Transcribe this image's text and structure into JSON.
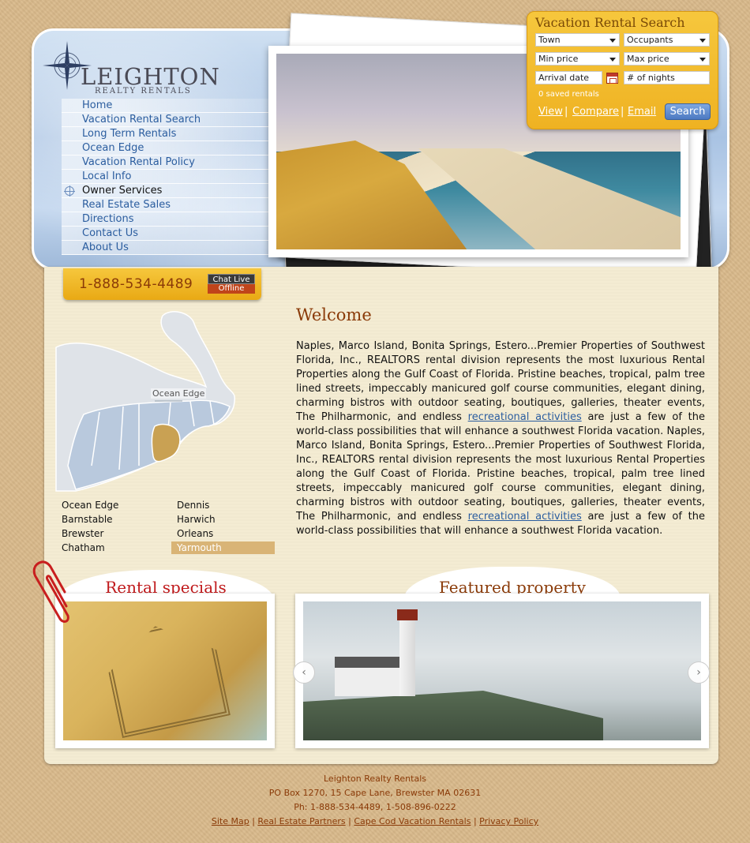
{
  "logo": {
    "name": "LEIGHTON",
    "tagline": "REALTY RENTALS"
  },
  "nav": {
    "items": [
      {
        "label": "Home"
      },
      {
        "label": "Vacation Rental Search"
      },
      {
        "label": "Long Term Rentals"
      },
      {
        "label": "Ocean Edge"
      },
      {
        "label": "Vacation Rental Policy"
      },
      {
        "label": "Local Info"
      },
      {
        "label": "Owner Services",
        "active": true
      },
      {
        "label": "Real Estate Sales"
      },
      {
        "label": "Directions"
      },
      {
        "label": "Contact Us"
      },
      {
        "label": "About Us"
      }
    ]
  },
  "search": {
    "title": "Vacation Rental Search",
    "town": "Town",
    "occupants": "Occupants",
    "min_price": "Min price",
    "max_price": "Max price",
    "arrival_date": "Arrival date",
    "nights": "# of nights",
    "saved": "0 saved rentals",
    "view": "View",
    "compare": "Compare",
    "email": "Email",
    "sep": "|",
    "button": "Search"
  },
  "phone": {
    "number": "1-888-534-4489",
    "chat_live": "Chat Live",
    "chat_status": "Offline"
  },
  "map": {
    "label": "Ocean Edge"
  },
  "towns": {
    "left": [
      "Ocean Edge",
      "Barnstable",
      "Brewster",
      "Chatham"
    ],
    "right": [
      "Dennis",
      "Harwich",
      "Orleans",
      "Yarmouth"
    ],
    "selected": "Yarmouth"
  },
  "welcome": {
    "title": "Welcome",
    "p1": "Naples, Marco Island, Bonita Springs, Estero...Premier Properties of Southwest Florida, Inc., REALTORS rental division represents the most luxurious Rental Properties along the Gulf Coast of Florida. Pristine beaches, tropical, palm tree lined streets, impeccably manicured golf course communities, elegant dining, charming bistros with outdoor seating, boutiques, galleries, theater events, The Philharmonic, and endless",
    "link1": "recreational activities",
    "p2": "are just a few of the world-class possibilities that will enhance a southwest Florida vacation. Naples, Marco Island, Bonita Springs, Estero...Premier Properties of Southwest Florida, Inc., REALTORS rental division represents the most luxurious Rental Properties along the Gulf Coast of Florida. Pristine beaches, tropical, palm tree lined streets, impeccably manicured golf course communities, elegant dining, charming bistros with outdoor seating, boutiques, galleries, theater events, The Philharmonic, and endless",
    "link2": "recreational activities",
    "p3": "are just a few of the world-class possibilities that will enhance a southwest Florida vacation."
  },
  "cards": {
    "specials_title": "Rental specials",
    "featured_title": "Featured property",
    "prev": "‹",
    "next": "›"
  },
  "footer": {
    "company": "Leighton Realty Rentals",
    "address": "PO Box 1270, 15 Cape Lane, Brewster MA 02631",
    "phone": "Ph: 1-888-534-4489, 1-508-896-0222",
    "links": [
      "Site Map",
      "Real Estate Partners",
      "Cape Cod Vacation Rentals",
      "Privacy Policy"
    ],
    "sep": "|"
  }
}
